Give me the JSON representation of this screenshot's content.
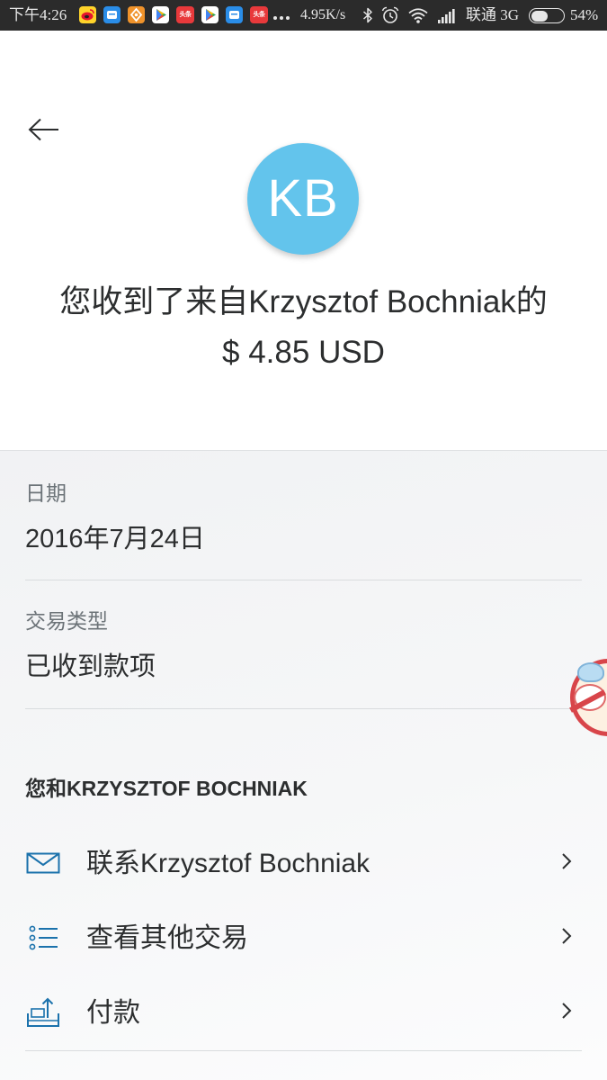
{
  "status_bar": {
    "time": "下午4:26",
    "notification_icons": [
      {
        "name": "weibo-icon",
        "color": "#ffd42a"
      },
      {
        "name": "message-app-icon",
        "color": "#2a8de8"
      },
      {
        "name": "orange-app-icon",
        "color": "#f0932b"
      },
      {
        "name": "play-store-icon",
        "color": "#ffffff"
      },
      {
        "name": "toutiao-icon",
        "color": "#e8393b",
        "text": "头条"
      },
      {
        "name": "play-store-icon",
        "color": "#ffffff"
      },
      {
        "name": "message-app-icon",
        "color": "#2a8de8"
      },
      {
        "name": "toutiao-icon",
        "color": "#e8393b",
        "text": "头条"
      }
    ],
    "net_speed": "4.95K/s",
    "carrier": "联通 3G",
    "battery_text": "54%",
    "battery_level": 0.54,
    "system_icons": [
      "more-notifications-icon",
      "bluetooth-icon",
      "alarm-icon",
      "wifi-icon",
      "signal-icon",
      "battery-icon"
    ]
  },
  "header": {
    "back_icon": "back-arrow-icon",
    "avatar_initials": "KB",
    "title": "您收到了来自Krzysztof Bochniak的",
    "amount": "$ 4.85 USD"
  },
  "details": [
    {
      "label": "日期",
      "value": "2016年7月24日"
    },
    {
      "label": "交易类型",
      "value": "已收到款项"
    }
  ],
  "section_title": "您和KRZYSZTOF BOCHNIAK",
  "actions": [
    {
      "icon": "mail-icon",
      "label": "联系Krzysztof Bochniak"
    },
    {
      "icon": "list-icon",
      "label": "查看其他交易"
    },
    {
      "icon": "send-payment-icon",
      "label": "付款"
    }
  ],
  "colors": {
    "status_bar_bg": "#2b2b2b",
    "avatar": "#63c4ec",
    "text_primary": "#2c2e2f",
    "text_secondary": "#6c7378",
    "action_icon": "#1b72ac",
    "divider": "#d9dcde"
  }
}
